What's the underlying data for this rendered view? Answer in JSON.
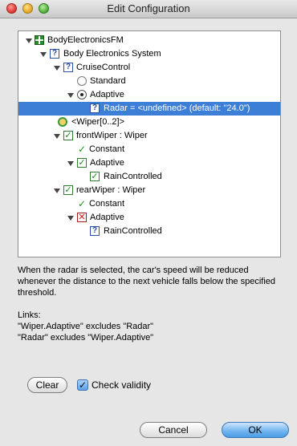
{
  "window": {
    "title": "Edit Configuration"
  },
  "tree": {
    "rows": [
      {
        "label": "BodyElectronicsFM"
      },
      {
        "label": "Body Electronics System"
      },
      {
        "label": "CruiseControl"
      },
      {
        "label": "Standard"
      },
      {
        "label": "Adaptive"
      },
      {
        "label": "Radar = <undefined> (default: \"24.0\")"
      },
      {
        "label": "<Wiper[0..2]>"
      },
      {
        "label": "frontWiper : Wiper"
      },
      {
        "label": "Constant"
      },
      {
        "label": "Adaptive"
      },
      {
        "label": "RainControlled"
      },
      {
        "label": "rearWiper : Wiper"
      },
      {
        "label": "Constant"
      },
      {
        "label": "Adaptive"
      },
      {
        "label": "RainControlled"
      }
    ],
    "icon_glyphs": {
      "unknown": "?",
      "checked": "✓",
      "excluded": "✕"
    }
  },
  "description": {
    "text": "When the radar is selected, the car's speed will be reduced whenever the distance to the next vehicle falls below the specified threshold.",
    "links_heading": "Links:",
    "links": [
      "\"Wiper.Adaptive\" excludes \"Radar\"",
      "\"Radar\" excludes \"Wiper.Adaptive\""
    ]
  },
  "controls": {
    "clear_label": "Clear",
    "check_validity_label": "Check validity",
    "check_validity_checked": true,
    "cancel_label": "Cancel",
    "ok_label": "OK"
  },
  "colors": {
    "selection": "#3d7fd6",
    "default_button": "#6fb3ef"
  }
}
